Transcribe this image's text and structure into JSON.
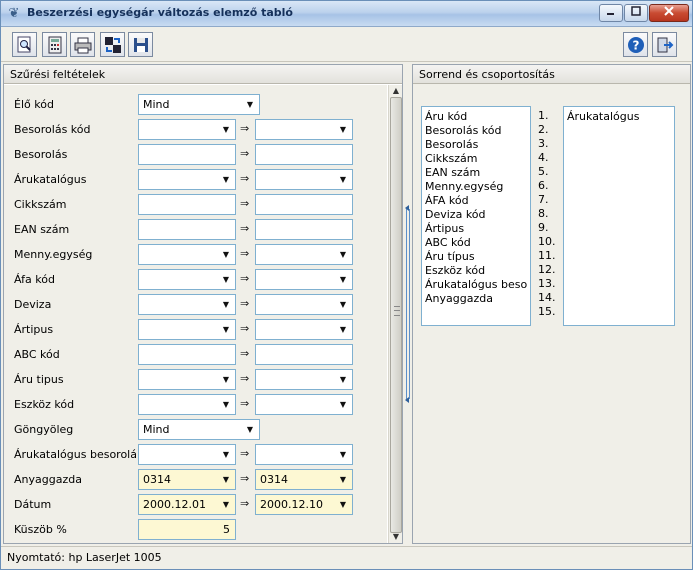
{
  "window": {
    "title": "Beszerzési egységár változás elemző tabló"
  },
  "toolbar": {
    "buttons": [
      {
        "name": "preview-button",
        "icon": "magnify-icon"
      },
      {
        "name": "calc-button",
        "icon": "calculator-icon"
      },
      {
        "name": "print-button",
        "icon": "printer-icon"
      },
      {
        "name": "export-button",
        "icon": "export-icon"
      },
      {
        "name": "save-button",
        "icon": "floppy-icon"
      },
      {
        "name": "help-button",
        "icon": "help-icon"
      },
      {
        "name": "exit-button",
        "icon": "exit-icon"
      }
    ]
  },
  "filters": {
    "header": "Szűrési feltételek",
    "arrow": "⇒",
    "rows": [
      {
        "label": "Élő kód",
        "from": "Mind",
        "to": ""
      },
      {
        "label": "Besorolás kód",
        "from": "",
        "to": ""
      },
      {
        "label": "Besorolás",
        "from": "",
        "to": ""
      },
      {
        "label": "Árukatalógus",
        "from": "",
        "to": ""
      },
      {
        "label": "Cikkszám",
        "from": "",
        "to": ""
      },
      {
        "label": "EAN szám",
        "from": "",
        "to": ""
      },
      {
        "label": "Menny.egység",
        "from": "",
        "to": ""
      },
      {
        "label": "Áfa kód",
        "from": "",
        "to": ""
      },
      {
        "label": "Deviza",
        "from": "",
        "to": ""
      },
      {
        "label": "Ártipus",
        "from": "",
        "to": ""
      },
      {
        "label": "ABC kód",
        "from": "",
        "to": ""
      },
      {
        "label": "Áru tipus",
        "from": "",
        "to": ""
      },
      {
        "label": "Eszköz kód",
        "from": "",
        "to": ""
      },
      {
        "label": "Göngyöleg",
        "from": "Mind",
        "to": ""
      },
      {
        "label": "Árukatalógus besorolá",
        "from": "",
        "to": ""
      },
      {
        "label": "Anyaggazda",
        "from": "0314",
        "to": "0314"
      },
      {
        "label": "Dátum",
        "from": "2000.12.01",
        "to": "2000.12.10"
      },
      {
        "label": "Küszöb %",
        "from": "5",
        "to": ""
      }
    ]
  },
  "sorting": {
    "header": "Sorrend és csoportosítás",
    "available": [
      "Áru kód",
      "Besorolás kód",
      "Besorolás",
      "Cikkszám",
      "EAN szám",
      "Menny.egység",
      "ÁFA kód",
      "Deviza kód",
      "Ártipus",
      "ABC kód",
      "Áru típus",
      "Eszköz kód",
      "Árukatalógus besor",
      "Anyaggazda"
    ],
    "numbers": [
      "1.",
      "2.",
      "3.",
      "4.",
      "5.",
      "6.",
      "7.",
      "8.",
      "9.",
      "10.",
      "11.",
      "12.",
      "13.",
      "14.",
      "15."
    ],
    "selected": [
      "Árukatalógus"
    ]
  },
  "status": {
    "text": "Nyomtató: hp LaserJet 1005"
  },
  "colors": {
    "field_border": "#7fb0d0",
    "highlight_field": "#fdf8d3",
    "title_text": "#15305a"
  }
}
